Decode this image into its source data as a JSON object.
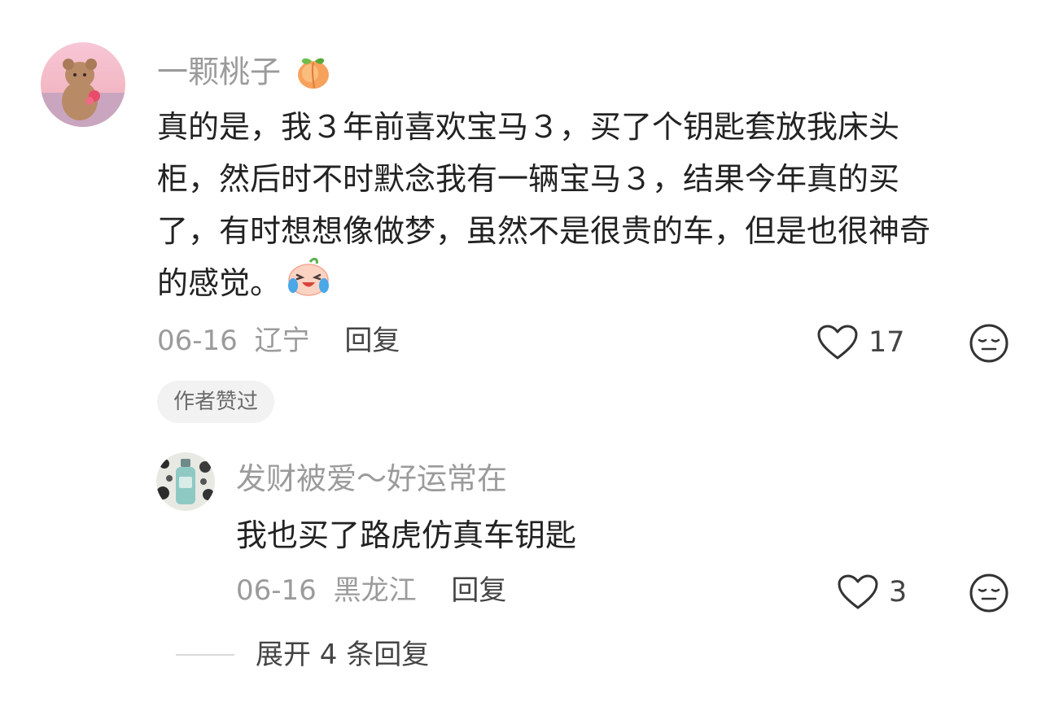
{
  "comment": {
    "username": "一颗桃子",
    "username_emoji": "peach-emoji",
    "lines": [
      "真的是，我３年前喜欢宝马３，买了个钥匙套放我床头",
      "柜，然后时不时默念我有一辆宝马３，结果今年真的买",
      "了，有时想想像做梦，虽然不是很贵的车，但是也很神奇",
      "的感觉。"
    ],
    "trailing_emoji": "crying-face-emoji",
    "date": "06-16",
    "location": "辽宁",
    "reply_label": "回复",
    "like_count": "17",
    "badge": "作者赞过"
  },
  "reply": {
    "username": "发财被爱～好运常在",
    "text": "我也买了路虎仿真车钥匙",
    "date": "06-16",
    "location": "黑龙江",
    "reply_label": "回复",
    "like_count": "3"
  },
  "expand_label": "展开 4 条回复",
  "icons": {
    "like": "heart-outline-icon",
    "dislike": "meh-face-icon"
  },
  "colors": {
    "username": "#9b9b9b",
    "body_text": "#222222",
    "meta": "#9b9b9b",
    "action": "#444444",
    "badge_bg": "#f2f2f2"
  }
}
